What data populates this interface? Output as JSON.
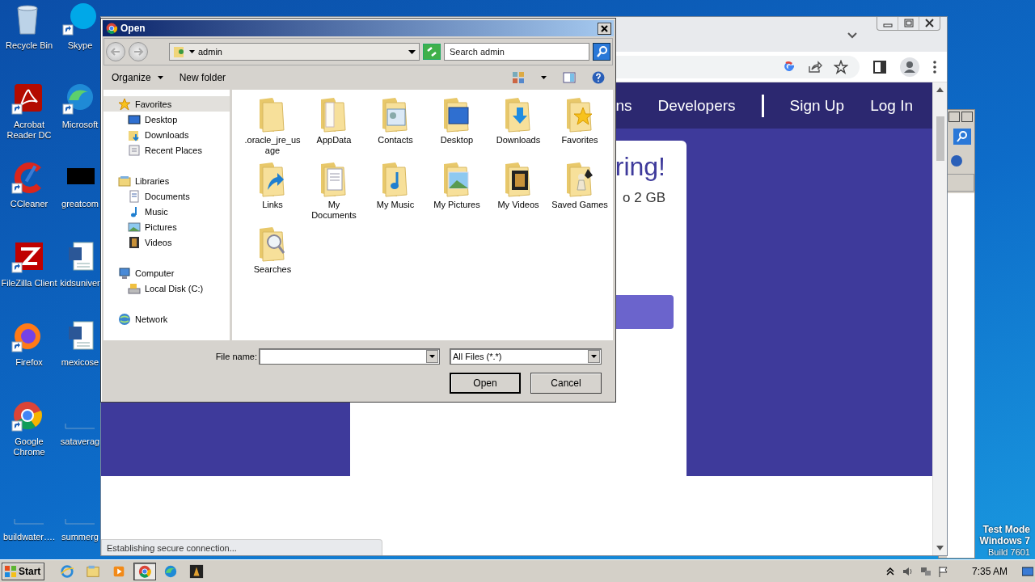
{
  "desktop_icons": [
    {
      "label": "Recycle Bin",
      "kind": "bin",
      "shortcut": false
    },
    {
      "label": "Skype",
      "kind": "skype",
      "shortcut": true
    },
    {
      "label": "Acrobat Reader DC",
      "kind": "acrobat",
      "shortcut": true
    },
    {
      "label": "Microsoft",
      "kind": "edge",
      "shortcut": true
    },
    {
      "label": "CCleaner",
      "kind": "ccleaner",
      "shortcut": true
    },
    {
      "label": "greatcom",
      "kind": "black",
      "shortcut": false
    },
    {
      "label": "FileZilla Client",
      "kind": "filezilla",
      "shortcut": true
    },
    {
      "label": "kidsuniver",
      "kind": "word",
      "shortcut": false
    },
    {
      "label": "Firefox",
      "kind": "firefox",
      "shortcut": true
    },
    {
      "label": "mexicose",
      "kind": "word",
      "shortcut": false
    },
    {
      "label": "Google Chrome",
      "kind": "chrome",
      "shortcut": true
    },
    {
      "label": "sataverag",
      "kind": "blank",
      "shortcut": false
    },
    {
      "label": "buildwater….",
      "kind": "blank",
      "shortcut": false
    },
    {
      "label": "summerg",
      "kind": "blank",
      "shortcut": false
    }
  ],
  "browser": {
    "nav_links": [
      "ns",
      "Developers"
    ],
    "auth_links": [
      "Sign Up",
      "Log In"
    ],
    "hero_heading": "ring!",
    "hero_text": "o 2 GB",
    "status": "Establishing secure connection..."
  },
  "dialog": {
    "title": "Open",
    "address": "admin",
    "search": {
      "placeholder": "Search admin"
    },
    "organize": "Organize",
    "new_folder": "New folder",
    "nav_tree": [
      {
        "label": "Favorites",
        "kind": "star",
        "selected": true,
        "children": [
          {
            "label": "Desktop",
            "kind": "desktop",
            "selected": false
          },
          {
            "label": "Downloads",
            "kind": "downloads",
            "selected": false
          },
          {
            "label": "Recent Places",
            "kind": "recent",
            "selected": false
          }
        ]
      },
      {
        "label": "Libraries",
        "kind": "library",
        "selected": false,
        "children": [
          {
            "label": "Documents",
            "kind": "documents",
            "selected": false
          },
          {
            "label": "Music",
            "kind": "music",
            "selected": false
          },
          {
            "label": "Pictures",
            "kind": "pictures",
            "selected": false
          },
          {
            "label": "Videos",
            "kind": "videos",
            "selected": false
          }
        ]
      },
      {
        "label": "Computer",
        "kind": "computer",
        "selected": false,
        "children": [
          {
            "label": "Local Disk (C:)",
            "kind": "disk",
            "selected": false
          }
        ]
      },
      {
        "label": "Network",
        "kind": "network",
        "selected": false
      }
    ],
    "files": [
      {
        "label": ".oracle_jre_usage",
        "kind": "plain"
      },
      {
        "label": "AppData",
        "kind": "papers"
      },
      {
        "label": "Contacts",
        "kind": "contact"
      },
      {
        "label": "Desktop",
        "kind": "screen"
      },
      {
        "label": "Downloads",
        "kind": "download"
      },
      {
        "label": "Favorites",
        "kind": "star"
      },
      {
        "label": "Links",
        "kind": "link"
      },
      {
        "label": "My Documents",
        "kind": "doc"
      },
      {
        "label": "My Music",
        "kind": "music"
      },
      {
        "label": "My Pictures",
        "kind": "picture"
      },
      {
        "label": "My Videos",
        "kind": "video"
      },
      {
        "label": "Saved Games",
        "kind": "games"
      },
      {
        "label": "Searches",
        "kind": "search"
      }
    ],
    "file_name_label": "File name:",
    "file_type": "All Files (*.*)",
    "buttons": [
      "Open",
      "Cancel"
    ]
  },
  "os_info": [
    "Test Mode",
    "Windows 7",
    "Build 7601"
  ],
  "taskbar": {
    "start": "Start",
    "apps": [
      {
        "kind": "ie",
        "selected": false
      },
      {
        "kind": "explorer",
        "selected": false
      },
      {
        "kind": "media",
        "selected": false
      },
      {
        "kind": "chrome",
        "selected": true
      },
      {
        "kind": "edge",
        "selected": false
      },
      {
        "kind": "game",
        "selected": false
      }
    ],
    "clock": "7:35 AM"
  }
}
